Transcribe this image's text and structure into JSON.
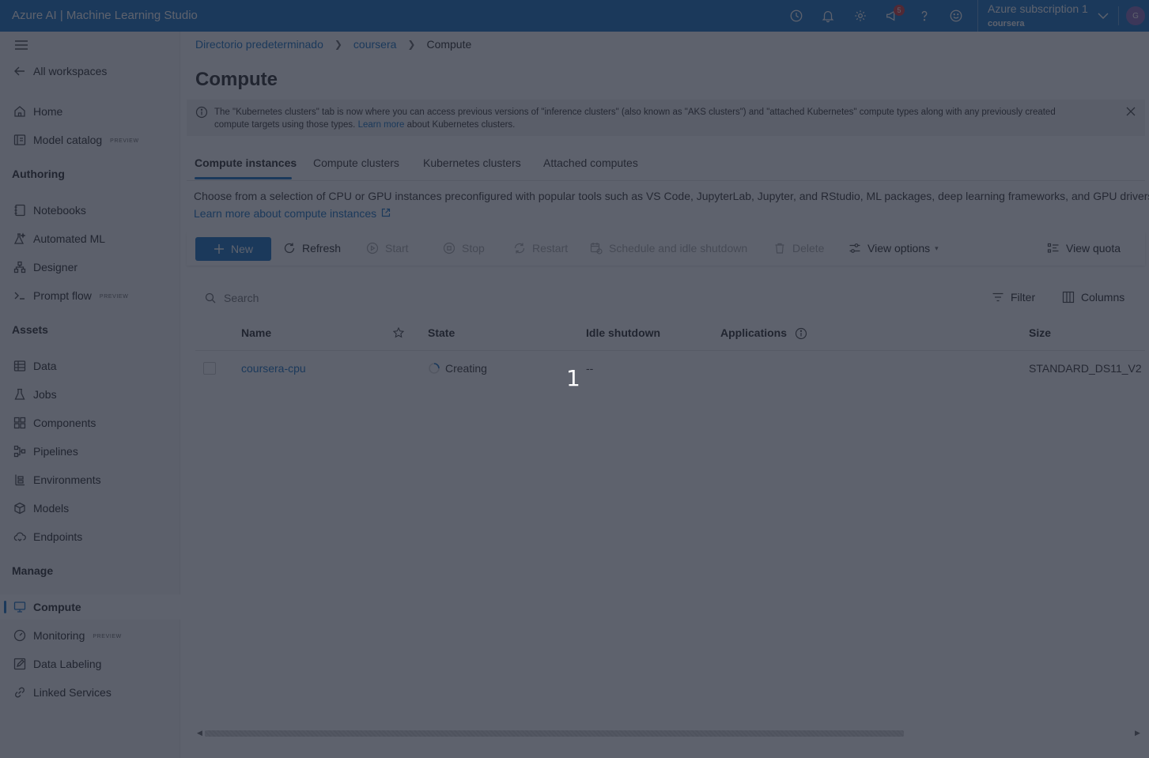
{
  "header": {
    "app_title": "Azure AI | Machine Learning Studio",
    "notification_badge": "5",
    "subscription": "Azure subscription 1",
    "workspace": "coursera",
    "avatar_initial": "G"
  },
  "sidebar": {
    "back_label": "All workspaces",
    "top_items": [
      {
        "label": "Home",
        "icon": "home-icon"
      },
      {
        "label": "Model catalog",
        "icon": "catalog-icon",
        "preview": "PREVIEW"
      }
    ],
    "sections": {
      "authoring": "Authoring",
      "assets": "Assets",
      "manage": "Manage"
    },
    "authoring_items": [
      {
        "label": "Notebooks"
      },
      {
        "label": "Automated ML"
      },
      {
        "label": "Designer"
      },
      {
        "label": "Prompt flow",
        "preview": "PREVIEW"
      }
    ],
    "assets_items": [
      {
        "label": "Data"
      },
      {
        "label": "Jobs"
      },
      {
        "label": "Components"
      },
      {
        "label": "Pipelines"
      },
      {
        "label": "Environments"
      },
      {
        "label": "Models"
      },
      {
        "label": "Endpoints"
      }
    ],
    "manage_items": [
      {
        "label": "Compute"
      },
      {
        "label": "Monitoring",
        "preview": "PREVIEW"
      },
      {
        "label": "Data Labeling"
      },
      {
        "label": "Linked Services"
      }
    ]
  },
  "breadcrumb": [
    "Directorio predeterminado",
    "coursera",
    "Compute"
  ],
  "page": {
    "title": "Compute"
  },
  "banner": {
    "text_before": "The \"Kubernetes clusters\" tab is now where you can access previous versions of \"inference clusters\" (also known as \"AKS clusters\") and \"attached Kubernetes\" compute types along with any previously created compute targets using those types.",
    "link": "Learn more",
    "text_after": "about Kubernetes clusters."
  },
  "tabs": [
    "Compute instances",
    "Compute clusters",
    "Kubernetes clusters",
    "Attached computes"
  ],
  "description": {
    "text": "Choose from a selection of CPU or GPU instances preconfigured with popular tools such as VS Code, JupyterLab, Jupyter, and RStudio, ML packages, deep learning frameworks, and GPU drivers.",
    "link": "Learn more about compute instances"
  },
  "toolbar": {
    "new": "New",
    "refresh": "Refresh",
    "start": "Start",
    "stop": "Stop",
    "restart": "Restart",
    "schedule": "Schedule and idle shutdown",
    "delete": "Delete",
    "view_options": "View options",
    "view_quota": "View quota"
  },
  "search": {
    "placeholder": "Search"
  },
  "filter": "Filter",
  "columns": "Columns",
  "table": {
    "headers": {
      "name": "Name",
      "state": "State",
      "idle": "Idle shutdown",
      "applications": "Applications",
      "size": "Size"
    },
    "rows": [
      {
        "name": "coursera-cpu",
        "state": "Creating",
        "idle": "--",
        "size": "STANDARD_DS11_V2"
      }
    ]
  },
  "step_marker": "1",
  "colors": {
    "accent": "#0f6cbd",
    "overlay": "#202634"
  }
}
